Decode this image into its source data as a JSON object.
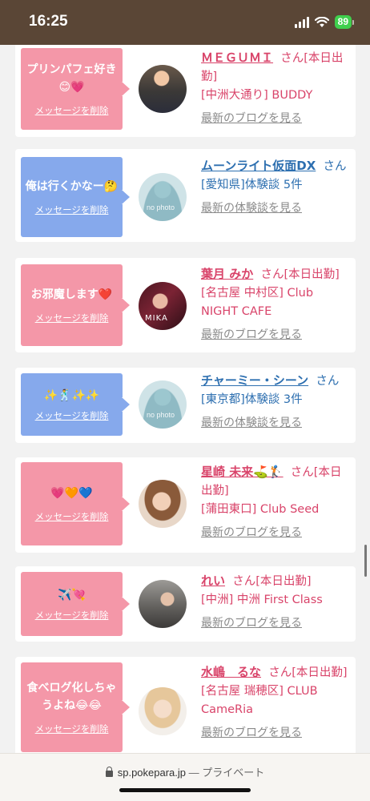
{
  "status": {
    "time": "16:25",
    "battery": "89"
  },
  "delete_label": "メッセージを削除",
  "cards": [
    {
      "message": "プリンパフェ好き😊💗",
      "name": "ＭＥＧＵＭＩ",
      "meta1": "さん[本日出勤]",
      "meta2": "[中洲大通り] BUDDY",
      "blog": "最新のブログを見る"
    },
    {
      "message": "俺は行くかなー🤔",
      "name": "ムーンライト仮面DX",
      "meta1": "さん",
      "meta2": "[愛知県]体験談 5件",
      "blog": "最新の体験談を見る",
      "photo_text": "no photo"
    },
    {
      "message": "お邪魔します❤️",
      "name": "葉月 みか",
      "meta1": "さん[本日出勤]",
      "meta2": "[名古屋 中村区] Club NIGHT CAFE",
      "blog": "最新のブログを見る",
      "photo_text": "MIKA"
    },
    {
      "message": "✨🕺✨✨",
      "name": "チャーミー・シーン",
      "meta1": "さん",
      "meta2": "[東京都]体験談 3件",
      "blog": "最新の体験談を見る",
      "photo_text": "no photo"
    },
    {
      "message": "💗🧡💙",
      "name": "星崎 未来⛳️🏌️",
      "meta1": "さん[本日出勤]",
      "meta2": "[蒲田東口] Club Seed",
      "blog": "最新のブログを見る"
    },
    {
      "message": "✈️💘",
      "name": "れい",
      "meta1": "さん[本日出勤]",
      "meta2": "[中洲] 中洲 First Class",
      "blog": "最新のブログを見る"
    },
    {
      "message": "食べログ化しちゃうよね😂😂",
      "name": "水嶋　るな",
      "meta1": "さん[本日出勤]",
      "meta2": "[名古屋 瑞穂区] CLUB CameRia",
      "blog": "最新のブログを見る"
    }
  ],
  "urlbar": {
    "domain": "sp.pokepara.jp",
    "suffix": "— プライベート"
  }
}
